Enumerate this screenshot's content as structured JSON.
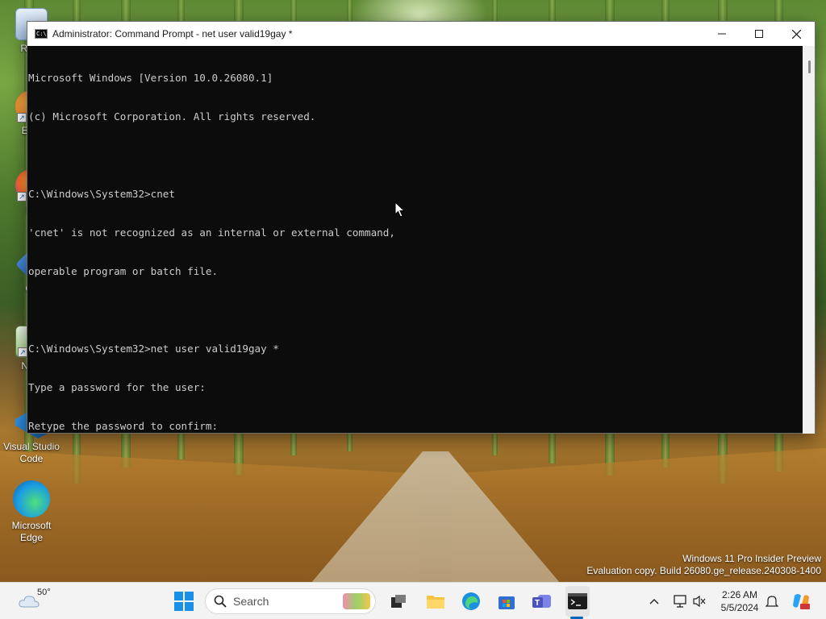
{
  "desktop": {
    "icons": [
      {
        "name": "recycle-bin",
        "label": "Recy"
      },
      {
        "name": "everything",
        "label": "Ever"
      },
      {
        "name": "firefox",
        "label": "Fir"
      },
      {
        "name": "git",
        "label": "Git"
      },
      {
        "name": "notepad",
        "label": "Note"
      },
      {
        "name": "vscode",
        "label": "Visual Studio Code"
      },
      {
        "name": "edge",
        "label": "Microsoft Edge"
      }
    ],
    "watermark": {
      "line1": "Windows 11 Pro Insider Preview",
      "line2": "Evaluation copy. Build 26080.ge_release.240308-1400"
    }
  },
  "window": {
    "title": "Administrator: Command Prompt - net  user valid19gay *",
    "icon": "cmd-icon",
    "buttons": {
      "minimize": "minimize-icon",
      "maximize": "maximize-icon",
      "close": "close-icon"
    },
    "console_lines": [
      "Microsoft Windows [Version 10.0.26080.1]",
      "(c) Microsoft Corporation. All rights reserved.",
      "",
      "C:\\Windows\\System32>cnet",
      "'cnet' is not recognized as an internal or external command,",
      "operable program or batch file.",
      "",
      "C:\\Windows\\System32>net user valid19gay *",
      "Type a password for the user:",
      "Retype the password to confirm:"
    ]
  },
  "taskbar": {
    "weather": {
      "temp": "50°",
      "icon": "cloud-icon"
    },
    "start_icon": "windows-start-icon",
    "search": {
      "label": "Search",
      "icon": "search-icon"
    },
    "pinned": [
      "task-view-icon",
      "file-explorer-icon",
      "edge-icon",
      "store-icon",
      "teams-icon",
      "terminal-icon"
    ],
    "tray": {
      "time": "2:26 AM",
      "date": "5/5/2024",
      "icons": [
        "chevron-up-icon",
        "network-icon",
        "volume-muted-icon",
        "notification-icon",
        "copilot-icon"
      ]
    }
  },
  "colors": {
    "console_bg": "#0c0c0c",
    "console_text": "#cccccc",
    "taskbar_bg": "#f3f3f3",
    "accent": "#0067c0"
  }
}
